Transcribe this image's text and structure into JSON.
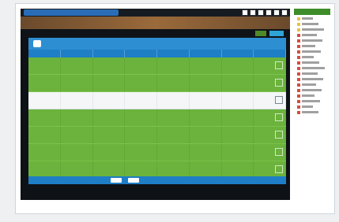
{
  "window": {
    "title": "",
    "toolbar_icons": [
      "window-icon",
      "window-icon",
      "window-icon",
      "window-icon",
      "window-icon",
      "window-icon"
    ]
  },
  "table": {
    "columns": [
      "",
      "",
      "",
      "",
      "",
      "",
      "",
      ""
    ],
    "rows": [
      {
        "cells": [
          "",
          "",
          "",
          "",
          "",
          "",
          "",
          ""
        ],
        "selected": false,
        "color": "#6bb33c"
      },
      {
        "cells": [
          "",
          "",
          "",
          "",
          "",
          "",
          "",
          ""
        ],
        "selected": false,
        "color": "#6bb33c"
      },
      {
        "cells": [
          "",
          "",
          "",
          "",
          "",
          "",
          "",
          ""
        ],
        "selected": true,
        "color": "#f4f6f8"
      },
      {
        "cells": [
          "",
          "",
          "",
          "",
          "",
          "",
          "",
          ""
        ],
        "selected": false,
        "color": "#6bb33c"
      },
      {
        "cells": [
          "",
          "",
          "",
          "",
          "",
          "",
          "",
          ""
        ],
        "selected": false,
        "color": "#6bb33c"
      },
      {
        "cells": [
          "",
          "",
          "",
          "",
          "",
          "",
          "",
          ""
        ],
        "selected": false,
        "color": "#6bb33c"
      },
      {
        "cells": [
          "",
          "",
          "",
          "",
          "",
          "",
          "",
          ""
        ],
        "selected": false,
        "color": "#6bb33c"
      }
    ]
  },
  "sidebar": {
    "items": [
      {
        "icon": "folder-icon",
        "icon_color": "#e9c146"
      },
      {
        "icon": "folder-icon",
        "icon_color": "#e9c146"
      },
      {
        "icon": "folder-icon",
        "icon_color": "#e9c146"
      },
      {
        "icon": "document-icon",
        "icon_color": "#d84b3f"
      },
      {
        "icon": "document-icon",
        "icon_color": "#d84b3f"
      },
      {
        "icon": "document-icon",
        "icon_color": "#d84b3f"
      },
      {
        "icon": "document-icon",
        "icon_color": "#d84b3f"
      },
      {
        "icon": "document-icon",
        "icon_color": "#d84b3f"
      },
      {
        "icon": "document-icon",
        "icon_color": "#d84b3f"
      },
      {
        "icon": "document-icon",
        "icon_color": "#d84b3f"
      },
      {
        "icon": "document-icon",
        "icon_color": "#d84b3f"
      },
      {
        "icon": "document-icon",
        "icon_color": "#d84b3f"
      },
      {
        "icon": "document-icon",
        "icon_color": "#d84b3f"
      },
      {
        "icon": "document-icon",
        "icon_color": "#d84b3f"
      },
      {
        "icon": "document-icon",
        "icon_color": "#d84b3f"
      },
      {
        "icon": "document-icon",
        "icon_color": "#d84b3f"
      },
      {
        "icon": "document-icon",
        "icon_color": "#d84b3f"
      },
      {
        "icon": "document-icon",
        "icon_color": "#d84b3f"
      }
    ]
  },
  "colors": {
    "panel": "#2d8ed1",
    "row_green": "#6bb33c",
    "row_selected": "#f4f6f8"
  }
}
